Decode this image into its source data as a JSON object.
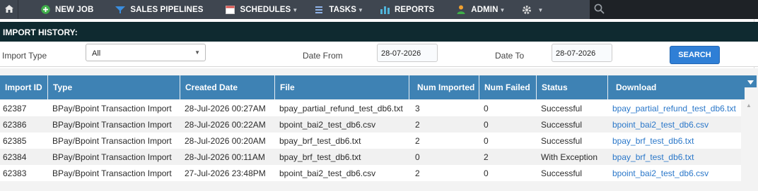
{
  "nav": {
    "items": [
      {
        "label": "NEW JOB",
        "icon": "plus-circle-icon"
      },
      {
        "label": "SALES PIPELINES",
        "icon": "funnel-icon"
      },
      {
        "label": "SCHEDULES",
        "icon": "calendar-icon"
      },
      {
        "label": "TASKS",
        "icon": "list-icon"
      },
      {
        "label": "REPORTS",
        "icon": "bar-chart-icon"
      },
      {
        "label": "ADMIN",
        "icon": "user-icon"
      }
    ]
  },
  "history": {
    "title": "IMPORT HISTORY:",
    "import_type_label": "Import Type",
    "import_type_value": "All",
    "date_from_label": "Date From",
    "date_from_value": "28-07-2026",
    "date_to_label": "Date To",
    "date_to_value": "28-07-2026",
    "search_label": "SEARCH"
  },
  "table": {
    "columns": [
      "Import ID",
      "Type",
      "Created Date",
      "File",
      "Num Imported",
      "Num Failed",
      "Status",
      "Download"
    ],
    "rows": [
      [
        "62387",
        "BPay/Bpoint Transaction Import",
        "28-Jul-2026 00:27AM",
        "bpay_partial_refund_test_db6.txt",
        "3",
        "0",
        "Successful",
        "bpay_partial_refund_test_db6.txt"
      ],
      [
        "62386",
        "BPay/Bpoint Transaction Import",
        "28-Jul-2026 00:22AM",
        "bpoint_bai2_test_db6.csv",
        "2",
        "0",
        "Successful",
        "bpoint_bai2_test_db6.csv"
      ],
      [
        "62385",
        "BPay/Bpoint Transaction Import",
        "28-Jul-2026 00:20AM",
        "bpay_brf_test_db6.txt",
        "2",
        "0",
        "Successful",
        "bpay_brf_test_db6.txt"
      ],
      [
        "62384",
        "BPay/Bpoint Transaction Import",
        "28-Jul-2026 00:11AM",
        "bpay_brf_test_db6.txt",
        "0",
        "2",
        "With Exception",
        "bpay_brf_test_db6.txt"
      ],
      [
        "62383",
        "BPay/Bpoint Transaction Import",
        "27-Jul-2026 23:48PM",
        "bpoint_bai2_test_db6.csv",
        "2",
        "0",
        "Successful",
        "bpoint_bai2_test_db6.csv"
      ]
    ]
  },
  "colors": {
    "nav_bg": "#3f4650",
    "header_bg": "#3e82b4",
    "title_bg": "#0f2a30",
    "link": "#2a77c9",
    "button": "#2f7fd6"
  }
}
